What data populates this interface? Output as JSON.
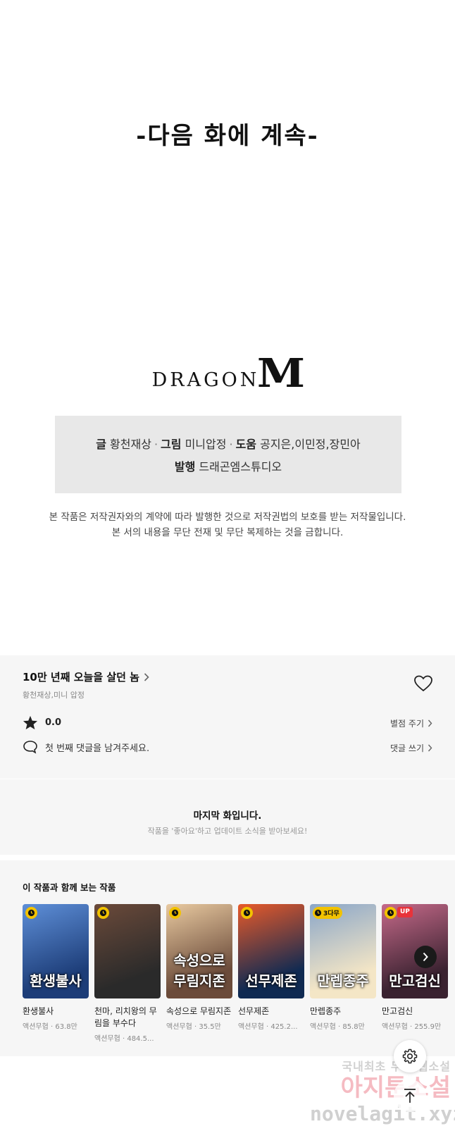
{
  "episode_end": {
    "continued_text": "-다음 화에 계속-"
  },
  "publisher_logo": {
    "text": "DRAGON",
    "mark": "M"
  },
  "credits": {
    "line1": [
      {
        "role": "글",
        "name": "황천재상"
      },
      {
        "role": "그림",
        "name": "미니압정"
      },
      {
        "role": "도움",
        "name": "공지은,이민정,장민아"
      }
    ],
    "line2": [
      {
        "role": "발행",
        "name": "드래곤엠스튜디오"
      }
    ],
    "separator": "·"
  },
  "copyright": {
    "line1": "본 작품은 저작권자와의 계약에 따라 발행한 것으로 저작권법의 보호를 받는 저작물입니다.",
    "line2": "본 서의 내용을 무단 전재 및 무단 복제하는 것을 금합니다."
  },
  "work_info": {
    "title": "10만 년째 오늘을 살던 놈",
    "authors": "황천재상,미니 압정",
    "rating": "0.0",
    "rate_label": "별점 주기",
    "comment_prompt": "첫 번째 댓글을 남겨주세요.",
    "comment_label": "댓글 쓰기",
    "icons": {
      "like": "heart-icon",
      "rating": "star-icon",
      "comment": "comment-icon",
      "chevron": "chevron-right-icon"
    }
  },
  "last_episode": {
    "title": "마지막 화입니다.",
    "subtitle": "작품을 '좋아요'하고 업데이트 소식을 받아보세요!"
  },
  "recommendations": {
    "heading": "이 작품과 함께 보는 작품",
    "items": [
      {
        "name": "환생불사",
        "meta": "액션무협 · 63.8만",
        "art": "환생불사",
        "badge": "clock",
        "colors": [
          "#1d3d78",
          "#5e8fd8"
        ]
      },
      {
        "name": "천마, 리치왕의 무림을 부수다",
        "meta": "액션무협 · 484.5...",
        "art": "",
        "badge": "clock",
        "colors": [
          "#2a2a2a",
          "#6b4a3a"
        ]
      },
      {
        "name": "속성으로 무림지존",
        "meta": "액션무협 · 35.5만",
        "art": "속성으로 무림지존",
        "badge": "clock",
        "colors": [
          "#6b4b3a",
          "#e8c9a0"
        ]
      },
      {
        "name": "선무제존",
        "meta": "액션무협 · 425.2...",
        "art": "선무제존",
        "badge": "clock",
        "colors": [
          "#0f2a52",
          "#e85a2a"
        ]
      },
      {
        "name": "만렙종주",
        "meta": "액션무협 · 85.8만",
        "art": "만렙종주",
        "badge": "3다무",
        "colors": [
          "#f4e6c6",
          "#8aa6c8"
        ]
      },
      {
        "name": "만고검신",
        "meta": "액션무협 · 255.9만",
        "art": "만고검신",
        "badge": "UP",
        "colors": [
          "#3a2230",
          "#c66a8a"
        ]
      }
    ]
  },
  "floating": {
    "settings_icon": "gear-icon",
    "scroll_top_icon": "arrow-up-icon",
    "next_icon": "chevron-right-icon"
  },
  "watermark": {
    "line1": "국내최초 무료 웹소설",
    "line2": "아지툰소설",
    "line3": "novelagit.xyz"
  }
}
